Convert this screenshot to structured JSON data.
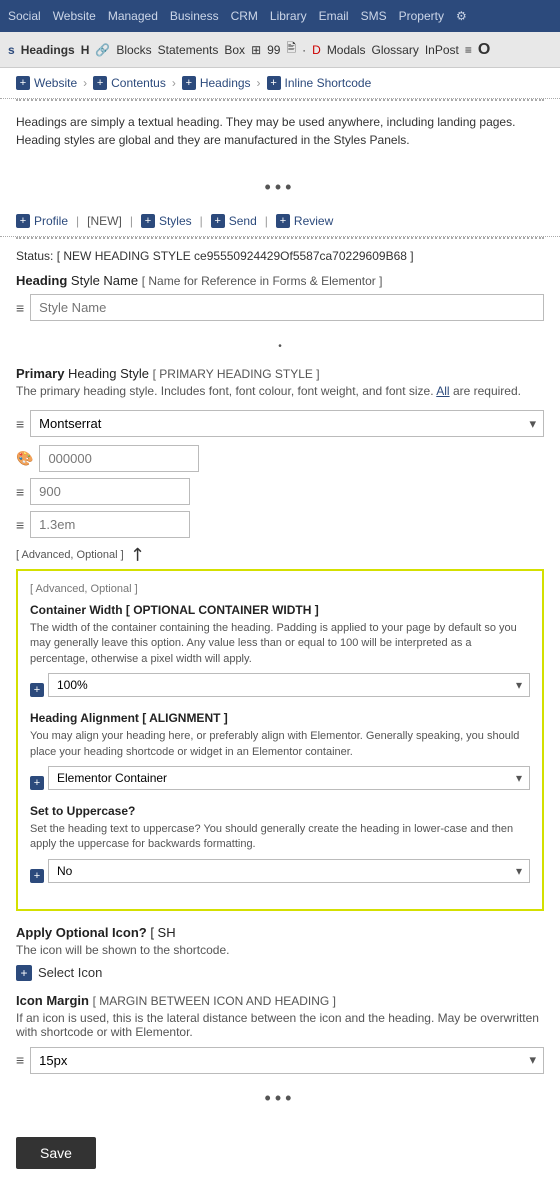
{
  "topnav": {
    "items": [
      "Social",
      "Website",
      "Managed",
      "Business",
      "CRM",
      "Library",
      "Email",
      "SMS",
      "Property",
      "⚙"
    ]
  },
  "toolbar": {
    "items": [
      {
        "label": "s",
        "type": "icon"
      },
      {
        "label": "Headings",
        "type": "active"
      },
      {
        "label": "H",
        "type": "bold"
      },
      {
        "label": "🔗",
        "type": "icon"
      },
      {
        "label": "Blocks",
        "type": "text"
      },
      {
        "label": "Statements",
        "type": "text"
      },
      {
        "label": "Box",
        "type": "text"
      },
      {
        "label": "⊞",
        "type": "icon"
      },
      {
        "label": "99",
        "type": "text"
      },
      {
        "label": "🖹",
        "type": "icon"
      },
      {
        "label": "·",
        "type": "text"
      },
      {
        "label": "D",
        "type": "icon"
      },
      {
        "label": "Modals",
        "type": "text"
      },
      {
        "label": "Glossary",
        "type": "text"
      },
      {
        "label": "InPost",
        "type": "text"
      },
      {
        "label": "≡",
        "type": "icon"
      },
      {
        "label": "O",
        "type": "icon"
      }
    ]
  },
  "breadcrumb": {
    "items": [
      {
        "label": "Website"
      },
      {
        "label": "Contentus"
      },
      {
        "label": "Headings"
      },
      {
        "label": "Inline Shortcode"
      }
    ]
  },
  "description": "Headings are simply a textual heading. They may be used anywhere, including landing pages. Heading styles are global and they are manufactured in the Styles Panels.",
  "styles_link": "Styles",
  "section_tabs": {
    "items": [
      "Profile",
      "[NEW]",
      "Styles",
      "Send",
      "Review"
    ]
  },
  "status": {
    "label": "Status:",
    "value": "[ NEW HEADING STYLE ce95550924429Of5587ca70229609B68 ]"
  },
  "heading_style_name": {
    "label": "Heading",
    "sublabel": "Style Name",
    "bracket": "[ Name for Reference in Forms & Elementor ]",
    "placeholder": "Style Name"
  },
  "primary_heading": {
    "title": "Primary",
    "subtitle": "Heading Style",
    "bracket": "[ PRIMARY HEADING STYLE ]",
    "desc": "The primary heading style. Includes font, font colour, font weight, and font size.",
    "all_label": "All",
    "all_note": "are required."
  },
  "font_field": {
    "value": "Montserrat"
  },
  "color_field": {
    "value": "000000"
  },
  "size_field": {
    "value": "900"
  },
  "line_height_field": {
    "value": "1.3em"
  },
  "advanced_optional_label": "[ Advanced, Optional ]",
  "popup": {
    "label": "[ Advanced, Optional ]",
    "container_width_title": "Container Width [ OPTIONAL CONTAINER WIDTH ]",
    "container_width_desc": "The width of the container containing the heading. Padding is applied to your page by default so you may generally leave this option. Any value less than or equal to 100 will be interpreted as a percentage, otherwise a pixel width will apply.",
    "container_width_plus_label": "100%",
    "container_width_value": "100%",
    "alignment_title": "Heading Alignment [ ALIGNMENT ]",
    "alignment_desc": "You may align your heading here, or preferably align with Elementor. Generally speaking, you should place your heading shortcode or widget in an Elementor container.",
    "alignment_value": "Elementor Container",
    "uppercase_title": "Set to Uppercase?",
    "uppercase_desc": "Set the heading text to uppercase? You should generally create the heading in lower-case and then apply the uppercase for backwards formatting.",
    "uppercase_value": "No"
  },
  "apply_icon": {
    "title_bold": "Apply Optional Icon?",
    "bracket": "[ SH",
    "desc": "The icon will be shown to the shortcode.",
    "button_label": "Select Icon"
  },
  "icon_margin": {
    "title_bold": "Icon Margin",
    "bracket": "[ MARGIN BETWEEN ICON AND HEADING ]",
    "desc": "If an icon is used, this is the lateral distance between the icon and the heading. May be overwritten with shortcode or with Elementor.",
    "value": "15px"
  },
  "save_button": "Save"
}
